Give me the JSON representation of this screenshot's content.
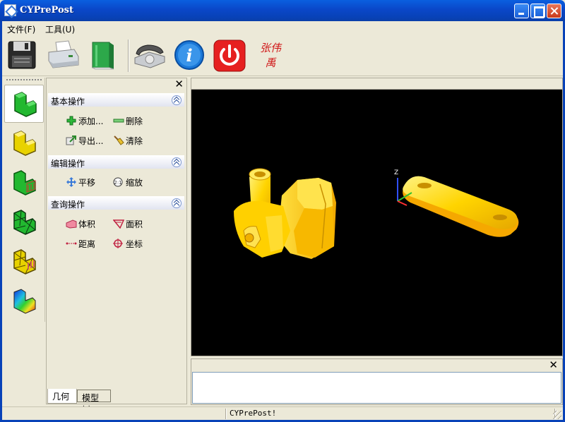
{
  "window": {
    "title": "CYPrePost"
  },
  "menu": [
    {
      "label": "文件(F)"
    },
    {
      "label": "工具(U)"
    }
  ],
  "toolbar": {
    "buttons": [
      {
        "icon": "floppy-disk-icon",
        "tooltip": ""
      },
      {
        "icon": "printer-icon",
        "tooltip": ""
      },
      {
        "icon": "book-icon",
        "tooltip": ""
      },
      {
        "icon": "telephone-icon",
        "tooltip": ""
      },
      {
        "icon": "info-icon",
        "tooltip": ""
      },
      {
        "icon": "power-icon",
        "tooltip": ""
      }
    ],
    "signature": "张伟禹"
  },
  "side_tools": [
    {
      "icon": "green-solid-block-icon",
      "active": true
    },
    {
      "icon": "yellow-solid-block-icon",
      "active": false
    },
    {
      "icon": "green-block-constraint-icon",
      "active": false
    },
    {
      "icon": "green-mesh-block-icon",
      "active": false
    },
    {
      "icon": "yellow-mesh-block-icon",
      "active": false
    },
    {
      "icon": "contour-result-block-icon",
      "active": false
    }
  ],
  "panel": {
    "groups": [
      {
        "title": "基本操作",
        "actions": [
          "添加...",
          "删除",
          "导出...",
          "清除"
        ]
      },
      {
        "title": "编辑操作",
        "actions": [
          "平移",
          "缩放"
        ]
      },
      {
        "title": "查询操作",
        "actions": [
          "体积",
          "面积",
          "距离",
          "坐标"
        ]
      }
    ],
    "tabs": [
      {
        "label": "几何",
        "active": true
      },
      {
        "label": "模型树",
        "active": false
      }
    ]
  },
  "viewport": {
    "axis_label": "Z",
    "background": "#000000",
    "model_color": "#ffcc00"
  },
  "statusbar": {
    "text": "CYPrePost!"
  },
  "colors": {
    "titlebar": "#0a47c8",
    "panel_bg": "#ece9d8",
    "accent": "#316ac5"
  }
}
